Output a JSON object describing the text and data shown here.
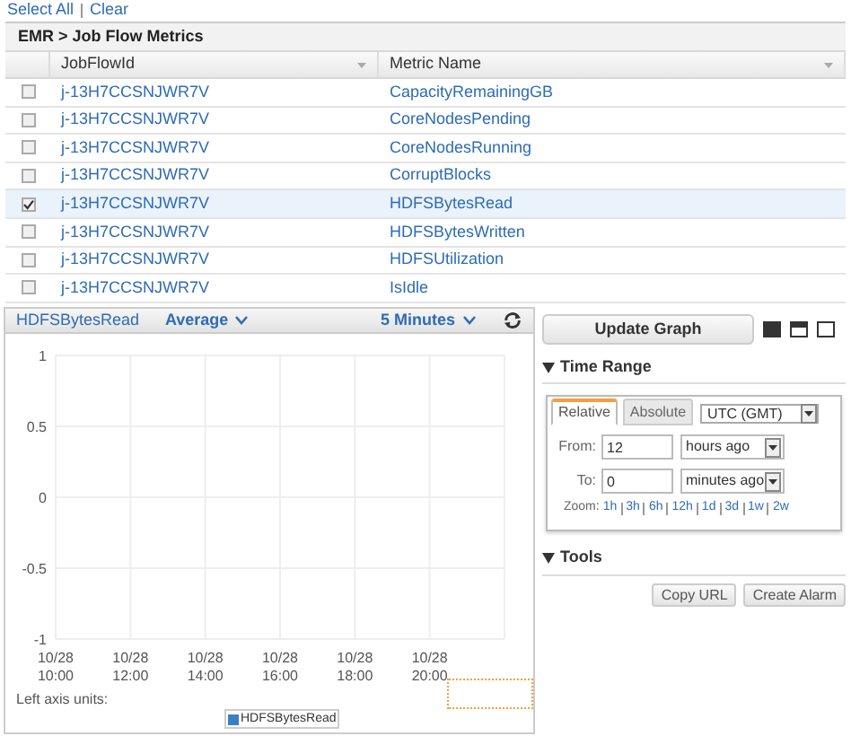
{
  "top_links": [
    "Select All",
    "Clear"
  ],
  "table": {
    "title": "EMR > Job Flow Metrics",
    "columns": [
      "JobFlowId",
      "Metric Name"
    ],
    "rows": [
      {
        "checked": false,
        "job_flow_id": "j-13H7CCSNJWR7V",
        "metric": "CapacityRemainingGB"
      },
      {
        "checked": false,
        "job_flow_id": "j-13H7CCSNJWR7V",
        "metric": "CoreNodesPending"
      },
      {
        "checked": false,
        "job_flow_id": "j-13H7CCSNJWR7V",
        "metric": "CoreNodesRunning"
      },
      {
        "checked": false,
        "job_flow_id": "j-13H7CCSNJWR7V",
        "metric": "CorruptBlocks"
      },
      {
        "checked": true,
        "job_flow_id": "j-13H7CCSNJWR7V",
        "metric": "HDFSBytesRead"
      },
      {
        "checked": false,
        "job_flow_id": "j-13H7CCSNJWR7V",
        "metric": "HDFSBytesWritten"
      },
      {
        "checked": false,
        "job_flow_id": "j-13H7CCSNJWR7V",
        "metric": "HDFSUtilization"
      },
      {
        "checked": false,
        "job_flow_id": "j-13H7CCSNJWR7V",
        "metric": "IsIdle"
      }
    ]
  },
  "graph": {
    "metric": "HDFSBytesRead",
    "statistic": "Average",
    "period": "5 Minutes",
    "left_axis_units": "Left axis units:",
    "chart_data": {
      "type": "line",
      "grid": true,
      "x": [
        "10/28 10:00",
        "10/28 12:00",
        "10/28 14:00",
        "10/28 16:00",
        "10/28 18:00",
        "10/28 20:00"
      ],
      "ylim": [
        -1,
        1
      ],
      "yticks": [
        -1,
        -0.5,
        0,
        0.5,
        1
      ],
      "series": [
        {
          "name": "HDFSBytesRead",
          "color": "#3b7fc4",
          "values": [
            null,
            null,
            null,
            null,
            null,
            null
          ]
        }
      ]
    }
  },
  "controls": {
    "update_button": "Update Graph",
    "time_range": {
      "heading": "Time Range",
      "tabs": [
        {
          "label": "Relative",
          "selected": true
        },
        {
          "label": "Absolute",
          "selected": false
        }
      ],
      "timezone": "UTC (GMT)",
      "from_label": "From:",
      "from_value": "12",
      "from_unit": "hours ago",
      "to_label": "To:",
      "to_value": "0",
      "to_unit": "minutes ago",
      "zoom_label": "Zoom:",
      "zoom_options": [
        "1h",
        "3h",
        "6h",
        "12h",
        "1d",
        "3d",
        "1w",
        "2w"
      ]
    },
    "tools": {
      "heading": "Tools",
      "buttons": [
        "Copy URL",
        "Create Alarm"
      ]
    }
  }
}
